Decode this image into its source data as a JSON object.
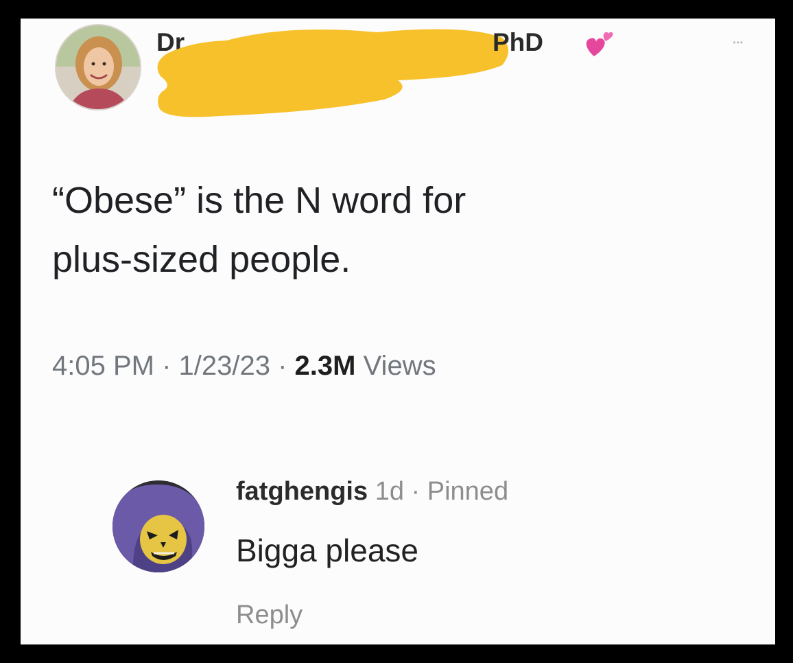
{
  "tweet": {
    "author_prefix": "Dr.",
    "author_suffix": "PhD",
    "emoji": "two-hearts-emoji",
    "text_line1": "“Obese” is the N word for",
    "text_line2": "plus-sized people.",
    "time": "4:05 PM",
    "date": "1/23/23",
    "views_count": "2.3M",
    "views_label": "Views",
    "separator": " · "
  },
  "comment": {
    "username": "fatghengis",
    "age": "1d",
    "pinned_label": "Pinned",
    "text": "Bigga please",
    "reply_label": "Reply"
  },
  "colors": {
    "redaction": "#f7c12b",
    "background": "#fcfcfd",
    "frame": "#000000",
    "heart": "#e4479b"
  }
}
